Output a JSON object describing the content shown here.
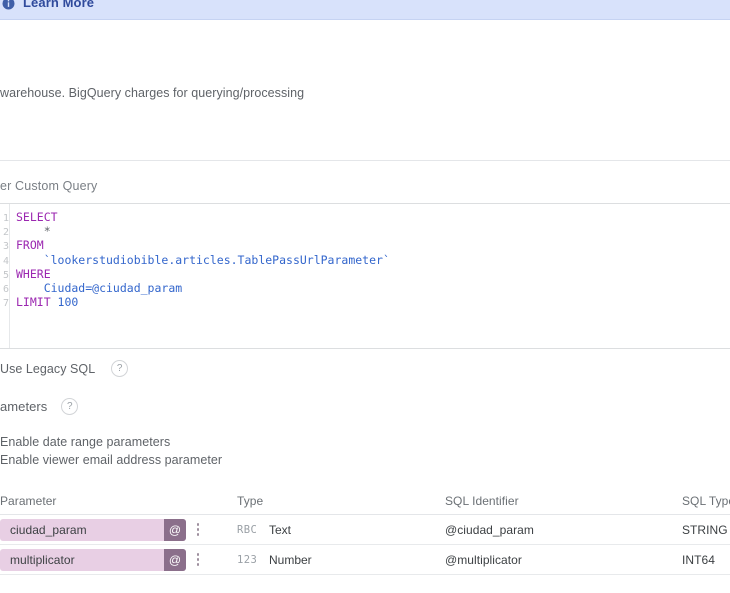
{
  "banner": {
    "icon": "info-icon",
    "link_label": "Learn More"
  },
  "description": {
    "text": "warehouse. BigQuery charges for querying/processing"
  },
  "custom_query": {
    "section_label": "er Custom Query",
    "sql_lines": [
      {
        "n": "1",
        "tokens": [
          {
            "t": "SELECT",
            "c": "kw"
          }
        ]
      },
      {
        "n": "2",
        "tokens": [
          {
            "t": "    *",
            "c": "star"
          }
        ]
      },
      {
        "n": "3",
        "tokens": [
          {
            "t": "FROM",
            "c": "kw"
          }
        ]
      },
      {
        "n": "4",
        "tokens": [
          {
            "t": "    `lookerstudiobible.articles.TablePassUrlParameter`",
            "c": "id"
          }
        ]
      },
      {
        "n": "5",
        "tokens": [
          {
            "t": "WHERE",
            "c": "kw"
          }
        ]
      },
      {
        "n": "6",
        "tokens": [
          {
            "t": "    Ciudad=@ciudad_param",
            "c": "id"
          }
        ]
      },
      {
        "n": "7",
        "tokens": [
          {
            "t": "LIMIT",
            "c": "kw"
          },
          {
            "t": " 100",
            "c": "num"
          }
        ]
      }
    ],
    "sql_plain": "SELECT\n    *\nFROM\n    `lookerstudiobible.articles.TablePassUrlParameter`\nWHERE\n    Ciudad=@ciudad_param\nLIMIT 100"
  },
  "legacy_sql": {
    "label": "Use Legacy SQL",
    "help": "?"
  },
  "parameters_section": {
    "heading": "ameters",
    "help": "?",
    "options": [
      {
        "label": "Enable date range parameters"
      },
      {
        "label": "Enable viewer email address parameter"
      }
    ]
  },
  "parameters_table": {
    "columns": {
      "parameter": "Parameter",
      "type": "Type",
      "sql_identifier": "SQL Identifier",
      "sql_type": "SQL Type"
    },
    "rows": [
      {
        "name": "ciudad_param",
        "at_badge": "@",
        "type_icon": "RBC",
        "type": "Text",
        "sql_identifier": "@ciudad_param",
        "sql_type": "STRING"
      },
      {
        "name": "multiplicator",
        "at_badge": "@",
        "type_icon": "123",
        "type": "Number",
        "sql_identifier": "@multiplicator",
        "sql_type": "INT64"
      }
    ]
  },
  "colors": {
    "banner_bg": "#d8e2fb",
    "banner_link": "#2f4a9c",
    "chip_bg": "#e8cfe4",
    "chip_badge": "#8b6f8b",
    "sql_keyword": "#9b27b0",
    "sql_identifier": "#3366cc"
  }
}
